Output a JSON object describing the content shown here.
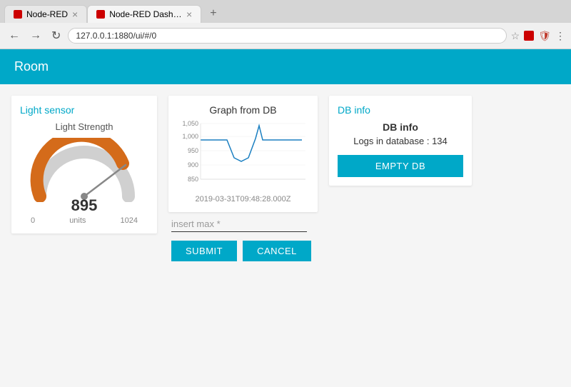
{
  "browser": {
    "tabs": [
      {
        "id": "tab1",
        "label": "Node-RED",
        "active": false,
        "icon": "node-red"
      },
      {
        "id": "tab2",
        "label": "Node-RED Dashb...",
        "active": true,
        "icon": "node-red-dash"
      }
    ],
    "address": "127.0.0.1:1880/ui/#/0",
    "new_tab_label": "+",
    "back_label": "←",
    "forward_label": "→",
    "refresh_label": "↻"
  },
  "page": {
    "title": "Room"
  },
  "light_sensor": {
    "section_title": "Light sensor",
    "gauge_label": "Light Strength",
    "value": 895,
    "unit": "units",
    "min": 0,
    "max": 1024,
    "gauge_color": "#d46b1a",
    "gauge_grey": "#c0c0c0"
  },
  "graph": {
    "title": "Graph from DB",
    "y_labels": [
      "1,050",
      "1,000",
      "950",
      "900",
      "850"
    ],
    "timestamp": "2019-03-31T09:48:28.000Z"
  },
  "form": {
    "input_placeholder": "insert max *",
    "submit_label": "SUBMIT",
    "cancel_label": "CANCEL"
  },
  "db_info": {
    "section_title": "DB info",
    "title": "DB info",
    "logs_label": "Logs in database : 134",
    "empty_db_label": "EMPTY DB"
  }
}
